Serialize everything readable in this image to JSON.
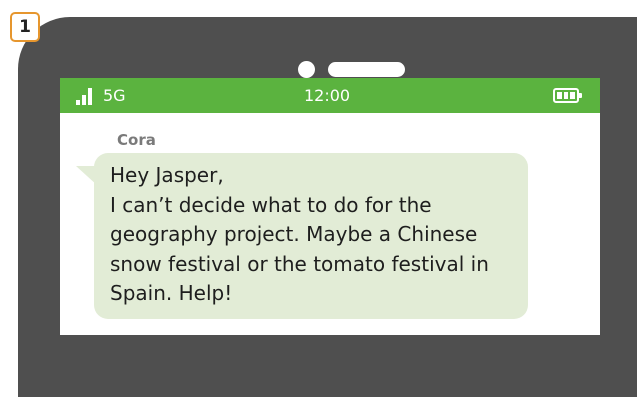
{
  "step_badge": "1",
  "status_bar": {
    "network": "5G",
    "time": "12:00"
  },
  "chat": {
    "sender": "Cora",
    "greeting": "Hey Jasper,",
    "body": "I can’t decide what to do for the geography project. Maybe a Chinese snow festival or the tomato festival in Spain. Help!"
  },
  "colors": {
    "phone_body": "#4f4f4f",
    "status_bar": "#5bb33f",
    "bubble": "#e2ecd6",
    "badge_border": "#e6962e"
  },
  "icons": [
    "signal-icon",
    "battery-icon",
    "camera-icon",
    "speaker-icon"
  ]
}
